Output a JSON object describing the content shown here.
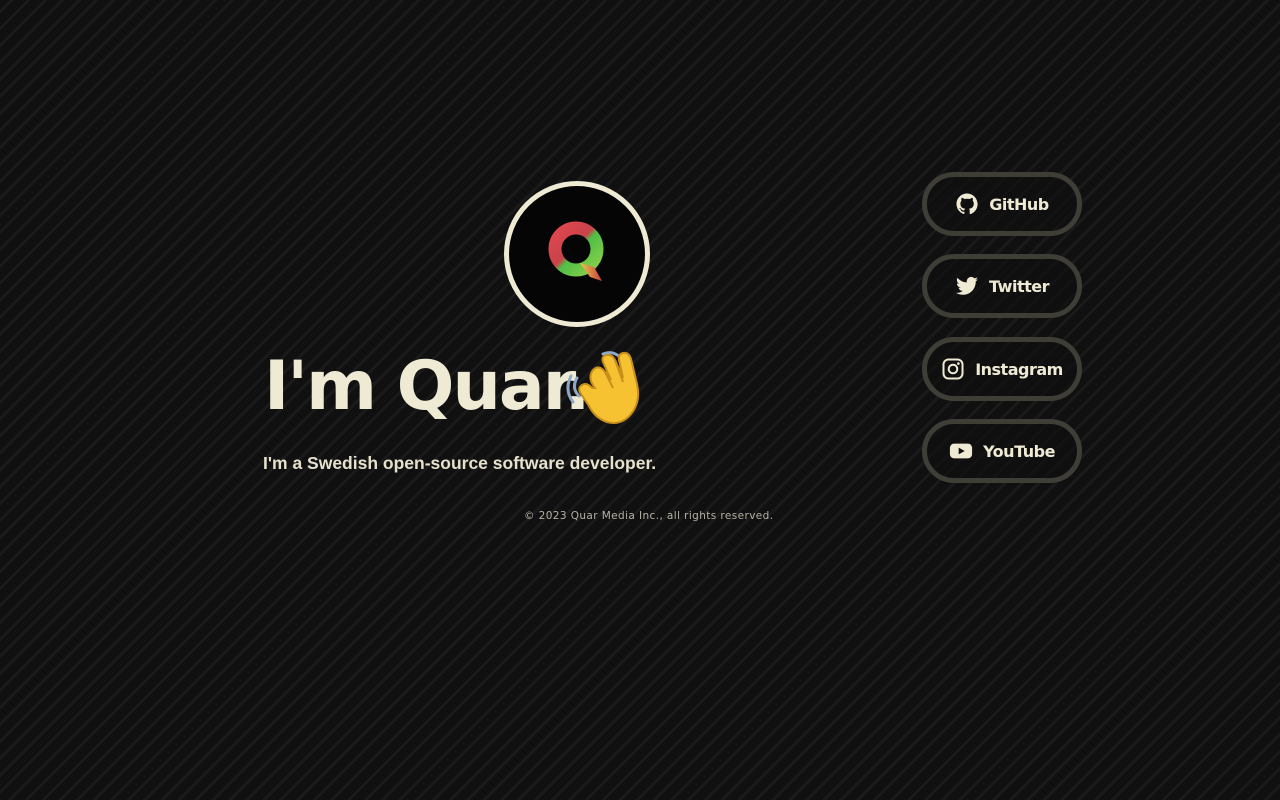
{
  "profile": {
    "avatar_icon": "q-logo-icon",
    "heading": "I'm Quar.",
    "wave_icon": "waving-hand-icon",
    "tagline": "I'm a Swedish open-source software developer."
  },
  "footer": {
    "copyright": "© 2023 Quar Media Inc., all rights reserved."
  },
  "social": [
    {
      "label": "GitHub",
      "icon": "github-icon"
    },
    {
      "label": "Twitter",
      "icon": "twitter-icon"
    },
    {
      "label": "Instagram",
      "icon": "instagram-icon"
    },
    {
      "label": "YouTube",
      "icon": "youtube-icon"
    }
  ],
  "colors": {
    "background": "#0d0d0d",
    "text": "#efead4",
    "button_border": "#3f3e36",
    "logo_red": "#e0474f",
    "logo_green": "#5fc44a",
    "logo_yellow": "#e8c94a"
  }
}
